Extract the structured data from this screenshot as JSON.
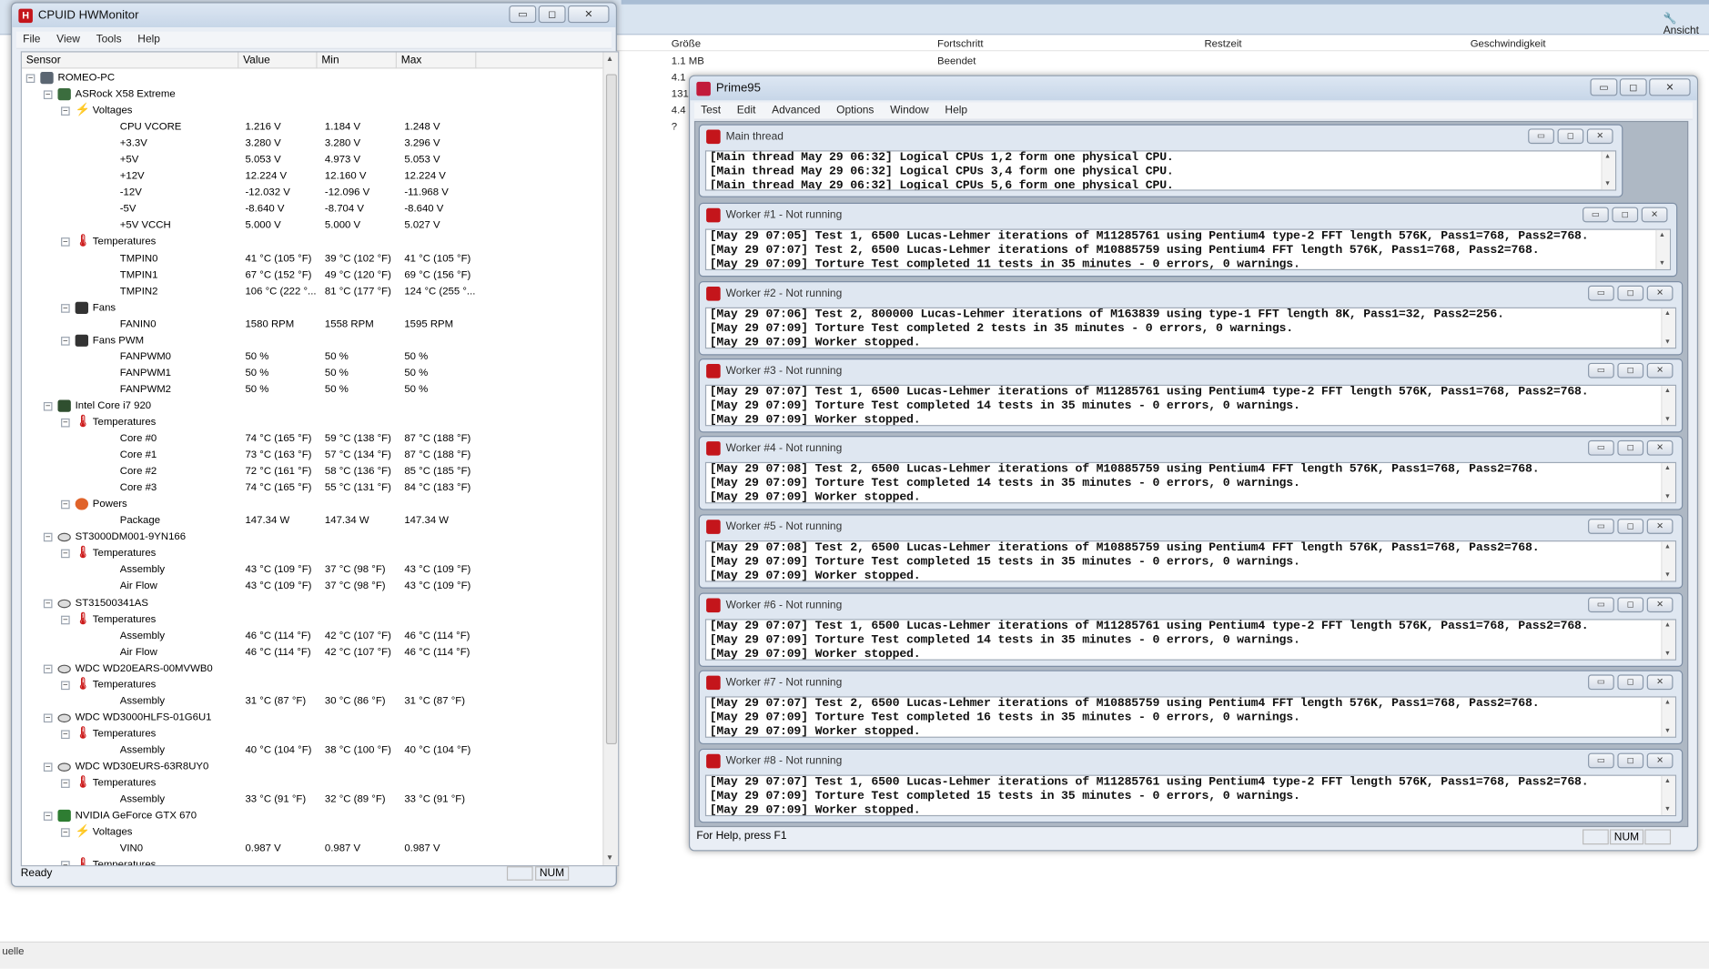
{
  "background": {
    "toolbar_label": "Ansicht",
    "columns": [
      "Größe",
      "Fortschritt",
      "Restzeit",
      "Geschwindigkeit"
    ],
    "rows": [
      {
        "size": "1.1 MB",
        "progress": "Beendet"
      },
      {
        "size": "4.1",
        "progress": ""
      },
      {
        "size": "131",
        "progress": ""
      },
      {
        "size": "4.4",
        "progress": ""
      },
      {
        "size": "?",
        "progress": ""
      }
    ],
    "footer_label": "uelle"
  },
  "hwmonitor": {
    "title": "CPUID HWMonitor",
    "menu": [
      "File",
      "View",
      "Tools",
      "Help"
    ],
    "columns": [
      "Sensor",
      "Value",
      "Min",
      "Max"
    ],
    "status": "Ready",
    "num": "NUM",
    "rows": [
      {
        "level": 0,
        "type": "node",
        "icon": "pc-icon",
        "name": "ROMEO-PC",
        "value": "",
        "min": "",
        "max": ""
      },
      {
        "level": 1,
        "type": "node",
        "icon": "motherboard-icon",
        "name": "ASRock X58 Extreme",
        "value": "",
        "min": "",
        "max": ""
      },
      {
        "level": 2,
        "type": "group",
        "icon": "voltage-icon",
        "name": "Voltages",
        "value": "",
        "min": "",
        "max": ""
      },
      {
        "level": 3,
        "type": "leaf",
        "name": "CPU VCORE",
        "value": "1.216 V",
        "min": "1.184 V",
        "max": "1.248 V"
      },
      {
        "level": 3,
        "type": "leaf",
        "name": "+3.3V",
        "value": "3.280 V",
        "min": "3.280 V",
        "max": "3.296 V"
      },
      {
        "level": 3,
        "type": "leaf",
        "name": "+5V",
        "value": "5.053 V",
        "min": "4.973 V",
        "max": "5.053 V"
      },
      {
        "level": 3,
        "type": "leaf",
        "name": "+12V",
        "value": "12.224 V",
        "min": "12.160 V",
        "max": "12.224 V"
      },
      {
        "level": 3,
        "type": "leaf",
        "name": "-12V",
        "value": "-12.032 V",
        "min": "-12.096 V",
        "max": "-11.968 V"
      },
      {
        "level": 3,
        "type": "leaf",
        "name": "-5V",
        "value": "-8.640 V",
        "min": "-8.704 V",
        "max": "-8.640 V"
      },
      {
        "level": 3,
        "type": "leaf",
        "name": "+5V VCCH",
        "value": "5.000 V",
        "min": "5.000 V",
        "max": "5.027 V"
      },
      {
        "level": 2,
        "type": "group",
        "icon": "temperature-icon",
        "name": "Temperatures",
        "value": "",
        "min": "",
        "max": ""
      },
      {
        "level": 3,
        "type": "leaf",
        "name": "TMPIN0",
        "value": "41 °C (105 °F)",
        "min": "39 °C (102 °F)",
        "max": "41 °C (105 °F)"
      },
      {
        "level": 3,
        "type": "leaf",
        "name": "TMPIN1",
        "value": "67 °C (152 °F)",
        "min": "49 °C (120 °F)",
        "max": "69 °C (156 °F)"
      },
      {
        "level": 3,
        "type": "leaf",
        "name": "TMPIN2",
        "value": "106 °C (222 °...",
        "min": "81 °C (177 °F)",
        "max": "124 °C (255 °..."
      },
      {
        "level": 2,
        "type": "group",
        "icon": "fan-icon",
        "name": "Fans",
        "value": "",
        "min": "",
        "max": ""
      },
      {
        "level": 3,
        "type": "leaf",
        "name": "FANIN0",
        "value": "1580 RPM",
        "min": "1558 RPM",
        "max": "1595 RPM"
      },
      {
        "level": 2,
        "type": "group",
        "icon": "fan-icon",
        "name": "Fans PWM",
        "value": "",
        "min": "",
        "max": ""
      },
      {
        "level": 3,
        "type": "leaf",
        "name": "FANPWM0",
        "value": "50 %",
        "min": "50 %",
        "max": "50 %"
      },
      {
        "level": 3,
        "type": "leaf",
        "name": "FANPWM1",
        "value": "50 %",
        "min": "50 %",
        "max": "50 %"
      },
      {
        "level": 3,
        "type": "leaf",
        "name": "FANPWM2",
        "value": "50 %",
        "min": "50 %",
        "max": "50 %"
      },
      {
        "level": 1,
        "type": "node",
        "icon": "cpu-icon",
        "name": "Intel Core i7 920",
        "value": "",
        "min": "",
        "max": ""
      },
      {
        "level": 2,
        "type": "group",
        "icon": "temperature-icon",
        "name": "Temperatures",
        "value": "",
        "min": "",
        "max": ""
      },
      {
        "level": 3,
        "type": "leaf",
        "name": "Core #0",
        "value": "74 °C (165 °F)",
        "min": "59 °C (138 °F)",
        "max": "87 °C (188 °F)"
      },
      {
        "level": 3,
        "type": "leaf",
        "name": "Core #1",
        "value": "73 °C (163 °F)",
        "min": "57 °C (134 °F)",
        "max": "87 °C (188 °F)"
      },
      {
        "level": 3,
        "type": "leaf",
        "name": "Core #2",
        "value": "72 °C (161 °F)",
        "min": "58 °C (136 °F)",
        "max": "85 °C (185 °F)"
      },
      {
        "level": 3,
        "type": "leaf",
        "name": "Core #3",
        "value": "74 °C (165 °F)",
        "min": "55 °C (131 °F)",
        "max": "84 °C (183 °F)"
      },
      {
        "level": 2,
        "type": "group",
        "icon": "power-icon",
        "name": "Powers",
        "value": "",
        "min": "",
        "max": ""
      },
      {
        "level": 3,
        "type": "leaf",
        "name": "Package",
        "value": "147.34 W",
        "min": "147.34 W",
        "max": "147.34 W"
      },
      {
        "level": 1,
        "type": "node",
        "icon": "disk-icon",
        "name": "ST3000DM001-9YN166",
        "value": "",
        "min": "",
        "max": ""
      },
      {
        "level": 2,
        "type": "group",
        "icon": "temperature-icon",
        "name": "Temperatures",
        "value": "",
        "min": "",
        "max": ""
      },
      {
        "level": 3,
        "type": "leaf",
        "name": "Assembly",
        "value": "43 °C (109 °F)",
        "min": "37 °C (98 °F)",
        "max": "43 °C (109 °F)"
      },
      {
        "level": 3,
        "type": "leaf",
        "name": "Air Flow",
        "value": "43 °C (109 °F)",
        "min": "37 °C (98 °F)",
        "max": "43 °C (109 °F)"
      },
      {
        "level": 1,
        "type": "node",
        "icon": "disk-icon",
        "name": "ST31500341AS",
        "value": "",
        "min": "",
        "max": ""
      },
      {
        "level": 2,
        "type": "group",
        "icon": "temperature-icon",
        "name": "Temperatures",
        "value": "",
        "min": "",
        "max": ""
      },
      {
        "level": 3,
        "type": "leaf",
        "name": "Assembly",
        "value": "46 °C (114 °F)",
        "min": "42 °C (107 °F)",
        "max": "46 °C (114 °F)"
      },
      {
        "level": 3,
        "type": "leaf",
        "name": "Air Flow",
        "value": "46 °C (114 °F)",
        "min": "42 °C (107 °F)",
        "max": "46 °C (114 °F)"
      },
      {
        "level": 1,
        "type": "node",
        "icon": "disk-icon",
        "name": "WDC WD20EARS-00MVWB0",
        "value": "",
        "min": "",
        "max": ""
      },
      {
        "level": 2,
        "type": "group",
        "icon": "temperature-icon",
        "name": "Temperatures",
        "value": "",
        "min": "",
        "max": ""
      },
      {
        "level": 3,
        "type": "leaf",
        "name": "Assembly",
        "value": "31 °C (87 °F)",
        "min": "30 °C (86 °F)",
        "max": "31 °C (87 °F)"
      },
      {
        "level": 1,
        "type": "node",
        "icon": "disk-icon",
        "name": "WDC WD3000HLFS-01G6U1",
        "value": "",
        "min": "",
        "max": ""
      },
      {
        "level": 2,
        "type": "group",
        "icon": "temperature-icon",
        "name": "Temperatures",
        "value": "",
        "min": "",
        "max": ""
      },
      {
        "level": 3,
        "type": "leaf",
        "name": "Assembly",
        "value": "40 °C (104 °F)",
        "min": "38 °C (100 °F)",
        "max": "40 °C (104 °F)"
      },
      {
        "level": 1,
        "type": "node",
        "icon": "disk-icon",
        "name": "WDC WD30EURS-63R8UY0",
        "value": "",
        "min": "",
        "max": ""
      },
      {
        "level": 2,
        "type": "group",
        "icon": "temperature-icon",
        "name": "Temperatures",
        "value": "",
        "min": "",
        "max": ""
      },
      {
        "level": 3,
        "type": "leaf",
        "name": "Assembly",
        "value": "33 °C (91 °F)",
        "min": "32 °C (89 °F)",
        "max": "33 °C (91 °F)"
      },
      {
        "level": 1,
        "type": "node",
        "icon": "gpu-icon",
        "name": "NVIDIA GeForce GTX 670",
        "value": "",
        "min": "",
        "max": ""
      },
      {
        "level": 2,
        "type": "group",
        "icon": "voltage-icon",
        "name": "Voltages",
        "value": "",
        "min": "",
        "max": ""
      },
      {
        "level": 3,
        "type": "leaf",
        "name": "VIN0",
        "value": "0.987 V",
        "min": "0.987 V",
        "max": "0.987 V"
      },
      {
        "level": 2,
        "type": "group",
        "icon": "temperature-icon",
        "name": "Temperatures",
        "value": "",
        "min": "",
        "max": ""
      }
    ]
  },
  "prime95": {
    "title": "Prime95",
    "menu": [
      "Test",
      "Edit",
      "Advanced",
      "Options",
      "Window",
      "Help"
    ],
    "status": "For Help, press F1",
    "num": "NUM",
    "windows": [
      {
        "title": "Main thread",
        "lines": [
          "[Main thread May 29 06:32] Logical CPUs 1,2 form one physical CPU.",
          "[Main thread May 29 06:32] Logical CPUs 3,4 form one physical CPU.",
          "[Main thread May 29 06:32] Logical CPUs 5,6 form one physical CPU."
        ]
      },
      {
        "title": "Worker #1 - Not running",
        "lines": [
          "[May 29 07:05] Test 1, 6500 Lucas-Lehmer iterations of M11285761 using Pentium4 type-2 FFT length 576K, Pass1=768, Pass2=768.",
          "[May 29 07:07] Test 2, 6500 Lucas-Lehmer iterations of M10885759 using Pentium4 FFT length 576K, Pass1=768, Pass2=768.",
          "[May 29 07:09] Torture Test completed 11 tests in 35 minutes - 0 errors, 0 warnings."
        ]
      },
      {
        "title": "Worker #2 - Not running",
        "lines": [
          "[May 29 07:06] Test 2, 800000 Lucas-Lehmer iterations of M163839 using type-1 FFT length 8K, Pass1=32, Pass2=256.",
          "[May 29 07:09] Torture Test completed 2 tests in 35 minutes - 0 errors, 0 warnings.",
          "[May 29 07:09] Worker stopped."
        ]
      },
      {
        "title": "Worker #3 - Not running",
        "lines": [
          "[May 29 07:07] Test 1, 6500 Lucas-Lehmer iterations of M11285761 using Pentium4 type-2 FFT length 576K, Pass1=768, Pass2=768.",
          "[May 29 07:09] Torture Test completed 14 tests in 35 minutes - 0 errors, 0 warnings.",
          "[May 29 07:09] Worker stopped."
        ]
      },
      {
        "title": "Worker #4 - Not running",
        "lines": [
          "[May 29 07:08] Test 2, 6500 Lucas-Lehmer iterations of M10885759 using Pentium4 FFT length 576K, Pass1=768, Pass2=768.",
          "[May 29 07:09] Torture Test completed 14 tests in 35 minutes - 0 errors, 0 warnings.",
          "[May 29 07:09] Worker stopped."
        ]
      },
      {
        "title": "Worker #5 - Not running",
        "lines": [
          "[May 29 07:08] Test 2, 6500 Lucas-Lehmer iterations of M10885759 using Pentium4 FFT length 576K, Pass1=768, Pass2=768.",
          "[May 29 07:09] Torture Test completed 15 tests in 35 minutes - 0 errors, 0 warnings.",
          "[May 29 07:09] Worker stopped."
        ]
      },
      {
        "title": "Worker #6 - Not running",
        "lines": [
          "[May 29 07:07] Test 1, 6500 Lucas-Lehmer iterations of M11285761 using Pentium4 type-2 FFT length 576K, Pass1=768, Pass2=768.",
          "[May 29 07:09] Torture Test completed 14 tests in 35 minutes - 0 errors, 0 warnings.",
          "[May 29 07:09] Worker stopped."
        ]
      },
      {
        "title": "Worker #7 - Not running",
        "lines": [
          "[May 29 07:07] Test 2, 6500 Lucas-Lehmer iterations of M10885759 using Pentium4 FFT length 576K, Pass1=768, Pass2=768.",
          "[May 29 07:09] Torture Test completed 16 tests in 35 minutes - 0 errors, 0 warnings.",
          "[May 29 07:09] Worker stopped."
        ]
      },
      {
        "title": "Worker #8 - Not running",
        "lines": [
          "[May 29 07:07] Test 1, 6500 Lucas-Lehmer iterations of M11285761 using Pentium4 type-2 FFT length 576K, Pass1=768, Pass2=768.",
          "[May 29 07:09] Torture Test completed 15 tests in 35 minutes - 0 errors, 0 warnings.",
          "[May 29 07:09] Worker stopped."
        ]
      }
    ]
  },
  "window_buttons": {
    "minimize": "▭",
    "maximize": "◻",
    "close": "✕"
  }
}
